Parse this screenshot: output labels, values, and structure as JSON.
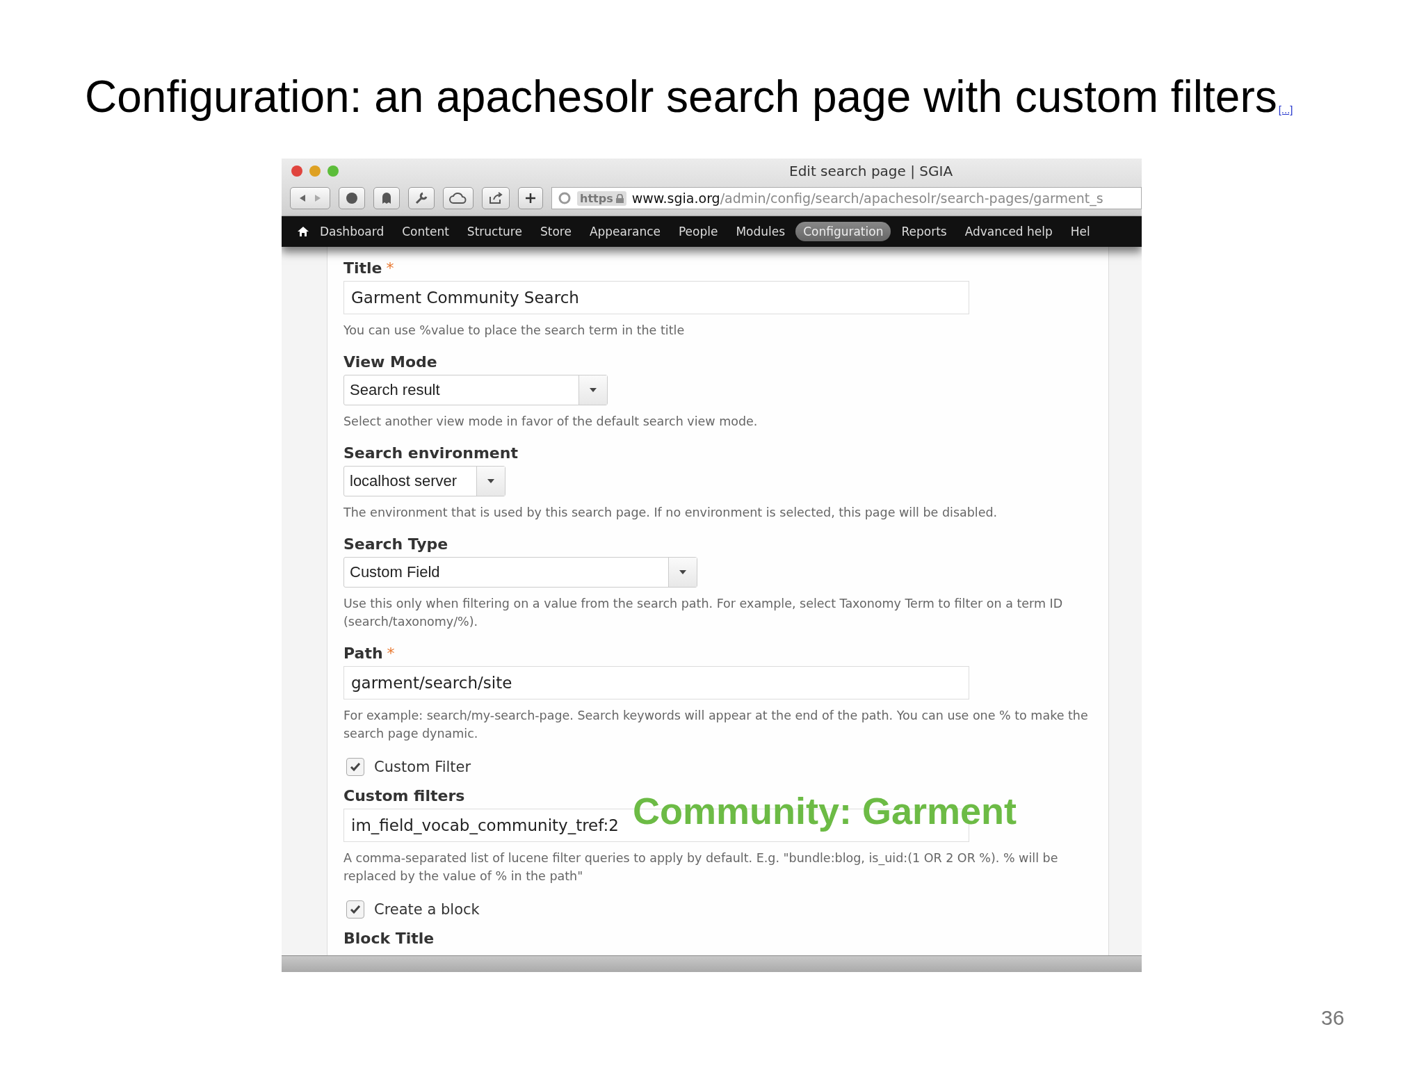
{
  "slide": {
    "title": "Configuration: an apachesolr search page with custom filters",
    "title_link": "[...]",
    "page_number": "36"
  },
  "browser": {
    "window_title": "Edit search page | SGIA",
    "url": {
      "scheme": "https",
      "domain": "www.sgia.org",
      "path": "/admin/config/search/apachesolr/search-pages/garment_s"
    }
  },
  "nav": {
    "items": [
      {
        "label": "Dashboard",
        "selected": false
      },
      {
        "label": "Content",
        "selected": false
      },
      {
        "label": "Structure",
        "selected": false
      },
      {
        "label": "Store",
        "selected": false
      },
      {
        "label": "Appearance",
        "selected": false
      },
      {
        "label": "People",
        "selected": false
      },
      {
        "label": "Modules",
        "selected": false
      },
      {
        "label": "Configuration",
        "selected": true
      },
      {
        "label": "Reports",
        "selected": false
      },
      {
        "label": "Advanced help",
        "selected": false
      },
      {
        "label": "Hel",
        "selected": false
      }
    ]
  },
  "form": {
    "items": [
      {
        "kind": "text",
        "label": "Title",
        "required_mark": "*",
        "value": "Garment Community Search",
        "help": "You can use %value to place the search term in the title"
      },
      {
        "kind": "select",
        "label": "View Mode",
        "value": "Search result",
        "help": "Select another view mode in favor of the default search view mode."
      },
      {
        "kind": "select",
        "label": "Search environment",
        "value": "localhost server",
        "help": "The environment that is used by this search page. If no environment is selected, this page will be disabled."
      },
      {
        "kind": "select",
        "label": "Search Type",
        "value": "Custom Field",
        "help": "Use this only when filtering on a value from the search path. For example, select Taxonomy Term to filter on a term ID (search/taxonomy/%)."
      },
      {
        "kind": "text",
        "label": "Path",
        "required_mark": "*",
        "value": "garment/search/site",
        "help": "For example: search/my-search-page. Search keywords will appear at the end of the path. You can use one % to make the search page dynamic."
      },
      {
        "kind": "checkbox",
        "label": "Custom Filter",
        "checked": true
      },
      {
        "kind": "text",
        "label": "Custom filters",
        "value": "im_field_vocab_community_tref:2",
        "help": "A comma-separated list of lucene filter queries to apply by default. E.g. \"bundle:blog, is_uid:(1 OR 2 OR %). % will be replaced by the value of % in the path\""
      },
      {
        "kind": "checkbox",
        "label": "Create a block",
        "checked": true
      },
      {
        "kind": "heading",
        "label": "Block Title"
      }
    ]
  },
  "callout": {
    "text": "Community: Garment"
  }
}
